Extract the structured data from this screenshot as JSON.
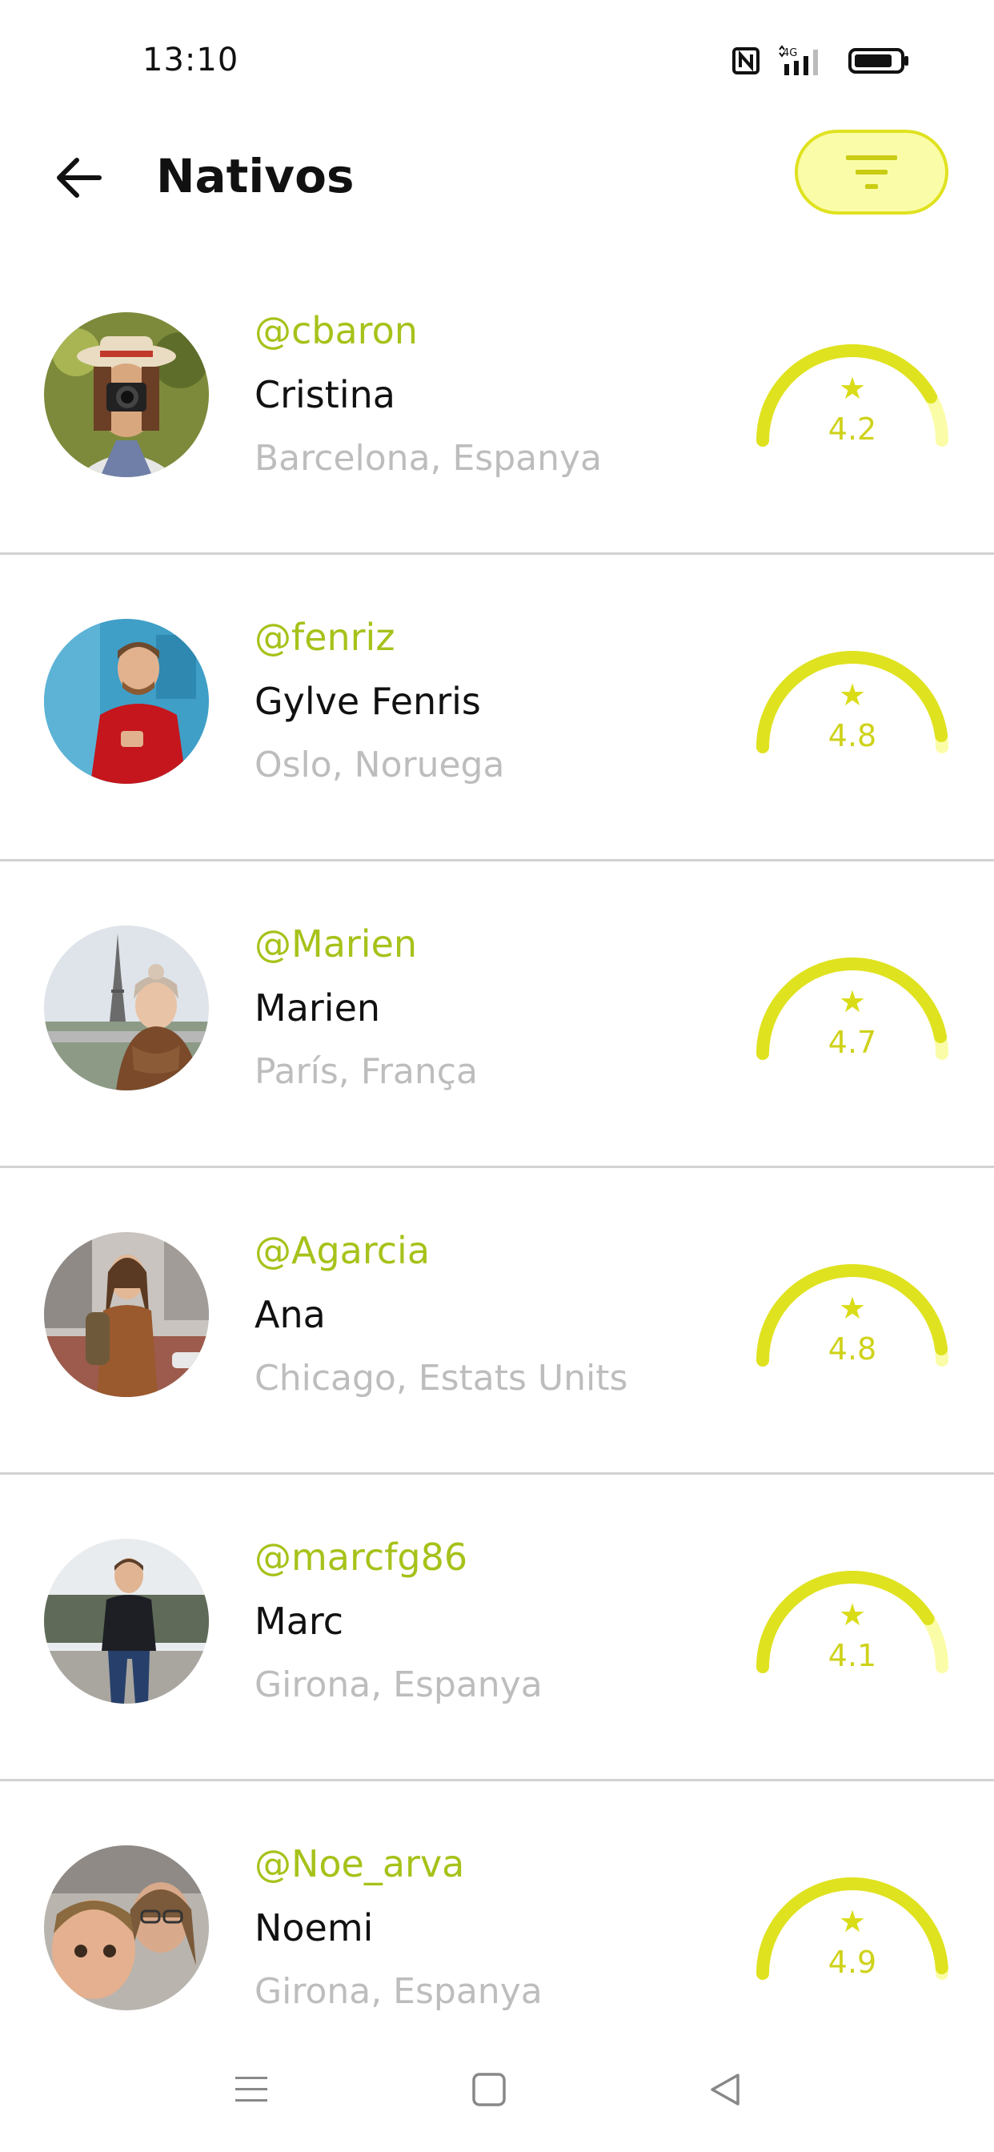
{
  "status_bar": {
    "time": "13:10",
    "network": "4G",
    "icons": [
      "nfc-icon",
      "signal-icon",
      "battery-icon"
    ]
  },
  "header": {
    "title": "Nativos",
    "back_icon": "arrow-left-icon",
    "filter_icon": "filter-icon"
  },
  "colors": {
    "accent": "#dfe21f",
    "accent_light": "#fbfca8",
    "username": "#a6c21a",
    "location": "#bdbdbd",
    "divider": "#d2d2d2"
  },
  "natives": [
    {
      "username": "@cbaron",
      "name": "Cristina",
      "location": "Barcelona, Espanya",
      "rating": "4.2",
      "rating_value": 4.2
    },
    {
      "username": "@fenriz",
      "name": "Gylve Fenris",
      "location": "Oslo, Noruega",
      "rating": "4.8",
      "rating_value": 4.8
    },
    {
      "username": "@Marien",
      "name": "Marien",
      "location": "París, França",
      "rating": "4.7",
      "rating_value": 4.7
    },
    {
      "username": "@Agarcia",
      "name": "Ana",
      "location": "Chicago, Estats Units",
      "rating": "4.8",
      "rating_value": 4.8
    },
    {
      "username": "@marcfg86",
      "name": "Marc",
      "location": "Girona, Espanya",
      "rating": "4.1",
      "rating_value": 4.1
    },
    {
      "username": "@Noe_arva",
      "name": "Noemi",
      "location": "Girona, Espanya",
      "rating": "4.9",
      "rating_value": 4.9
    }
  ],
  "nav_bar": {
    "icons": [
      "menu-icon",
      "home-square-icon",
      "back-triangle-icon"
    ]
  }
}
